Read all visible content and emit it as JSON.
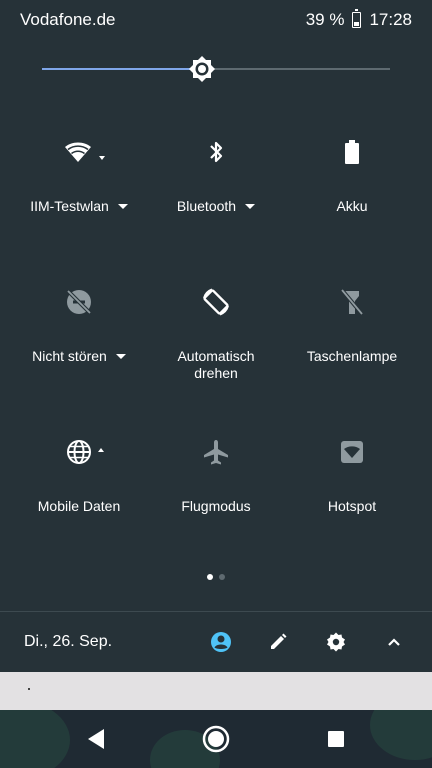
{
  "status_bar": {
    "carrier": "Vodafone.de",
    "battery_percent": "39 %",
    "battery_level": 0.39,
    "time": "17:28"
  },
  "brightness": {
    "level": 0.46
  },
  "tiles": [
    {
      "label": "IIM-Testwlan",
      "icon": "wifi-icon",
      "has_dropdown": true,
      "active": true
    },
    {
      "label": "Bluetooth",
      "icon": "bluetooth-icon",
      "has_dropdown": true,
      "active": true
    },
    {
      "label": "Akku",
      "icon": "battery-icon",
      "has_dropdown": false,
      "active": true
    },
    {
      "label": "Nicht stören",
      "icon": "do-not-disturb-off-icon",
      "has_dropdown": true,
      "active": false
    },
    {
      "label": "Automatisch drehen",
      "icon": "auto-rotate-icon",
      "has_dropdown": false,
      "active": true
    },
    {
      "label": "Taschenlampe",
      "icon": "flashlight-off-icon",
      "has_dropdown": false,
      "active": false
    },
    {
      "label": "Mobile Daten",
      "icon": "globe-icon",
      "has_dropdown": false,
      "active": true
    },
    {
      "label": "Flugmodus",
      "icon": "airplane-icon",
      "has_dropdown": false,
      "active": false
    },
    {
      "label": "Hotspot",
      "icon": "hotspot-icon",
      "has_dropdown": false,
      "active": false
    }
  ],
  "pager": {
    "pages": 2,
    "current": 1
  },
  "footer": {
    "date": "Di., 26. Sep.",
    "icons": [
      "user-icon",
      "edit-icon",
      "settings-icon",
      "collapse-icon"
    ]
  },
  "colors": {
    "panel_bg": "#263238",
    "accent": "#7fa6e8",
    "user_icon": "#4fc3f7",
    "inactive_icon": "#8f9a9f"
  },
  "nav_bar": {
    "buttons": [
      "back-icon",
      "home-icon",
      "recents-icon"
    ]
  }
}
